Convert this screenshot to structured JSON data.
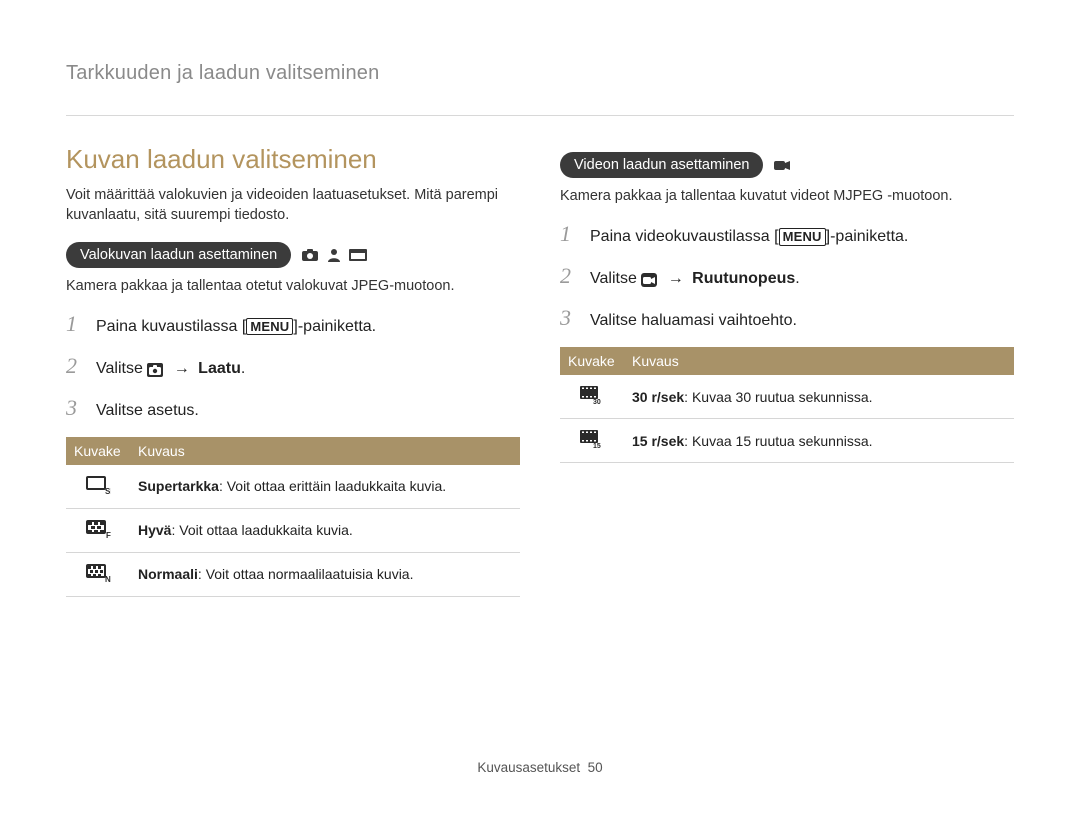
{
  "breadcrumb": "Tarkkuuden ja laadun valitseminen",
  "h2": "Kuvan laadun valitseminen",
  "intro": "Voit määrittää valokuvien ja videoiden laatuasetukset. Mitä parempi kuvanlaatu, sitä suurempi tiedosto.",
  "photo": {
    "pill": "Valokuvan laadun asettaminen",
    "caption": "Kamera pakkaa ja tallentaa otetut valokuvat JPEG-muotoon.",
    "step1_a": "Paina kuvaustilassa [",
    "step1_b": "]-painiketta.",
    "menu_label": "MENU",
    "step2_a": "Valitse ",
    "step2_arrow": " → ",
    "step2_b": "Laatu",
    "step2_c": ".",
    "step3": "Valitse asetus.",
    "th1": "Kuvake",
    "th2": "Kuvaus",
    "row1_b": "Supertarkka",
    "row1_t": ": Voit ottaa erittäin laadukkaita kuvia.",
    "row2_b": "Hyvä",
    "row2_t": ": Voit ottaa laadukkaita kuvia.",
    "row3_b": "Normaali",
    "row3_t": ": Voit ottaa normaalilaatuisia kuvia."
  },
  "video": {
    "pill": "Videon laadun asettaminen",
    "caption": "Kamera pakkaa ja tallentaa kuvatut videot MJPEG -muotoon.",
    "step1_a": "Paina videokuvaustilassa [",
    "step1_b": "]-painiketta.",
    "menu_label": "MENU",
    "step2_a": "Valitse ",
    "step2_arrow": " → ",
    "step2_b": "Ruutunopeus",
    "step2_c": ".",
    "step3": "Valitse haluamasi vaihtoehto.",
    "th1": "Kuvake",
    "th2": "Kuvaus",
    "row1_b": "30 r/sek",
    "row1_t": ": Kuvaa 30 ruutua sekunnissa.",
    "row2_b": "15 r/sek",
    "row2_t": ": Kuvaa 15 ruutua sekunnissa."
  },
  "footer_label": "Kuvausasetukset",
  "footer_page": "50"
}
